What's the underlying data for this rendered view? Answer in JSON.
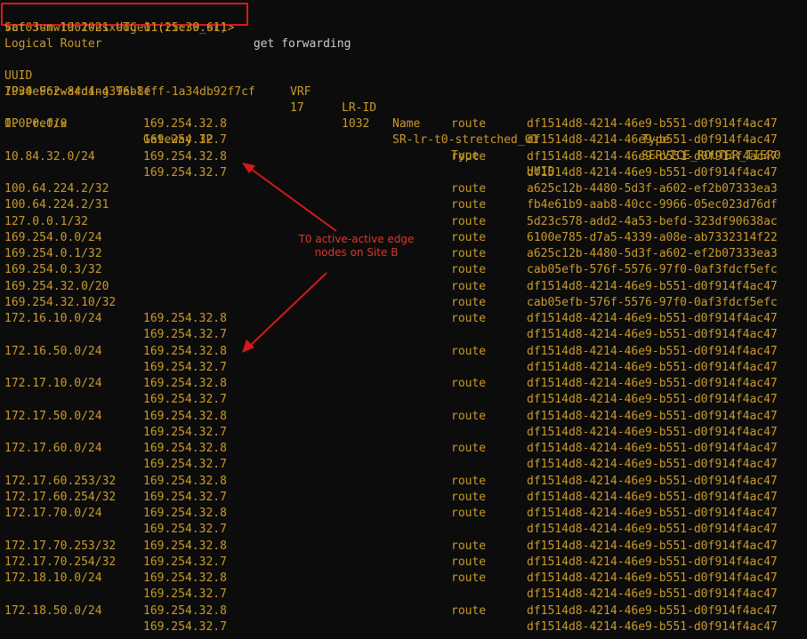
{
  "colors": {
    "background": "#0c0c0c",
    "text": "#ca9a2a",
    "command": "#cccccc",
    "annotation": "#d63a2a"
  },
  "prompt": {
    "host": "vcf03-mwld01-nsxedge01(tier0_sr)>",
    "command": " get forwarding"
  },
  "timestamp": "Sat Jun 19 2021 UTC 11:25:39.611",
  "logical_router_title": "Logical Router",
  "router_headers": {
    "uuid": "UUID",
    "vrf": "VRF",
    "lrid": "LR-ID",
    "name": "Name",
    "type": "Type"
  },
  "router": {
    "uuid": "7930e962-84d4-4396-8fff-1a34db92f7cf",
    "vrf": "17",
    "lrid": "1032",
    "name": "SR-lr-t0-stretched_01",
    "type": "SERVICE_ROUTER_TIER0"
  },
  "table_title": "IPv4 Forwarding Table",
  "table_headers": {
    "prefix": "IP Prefix",
    "gateway": "Gateway IP",
    "type": "Type",
    "uuid": "UUID"
  },
  "rows": [
    {
      "prefix": "0.0.0.0/0",
      "gateway": "169.254.32.8",
      "type": "route",
      "uuid": "df1514d8-4214-46e9-b551-d0f914f4ac47"
    },
    {
      "prefix": "",
      "gateway": "169.254.32.7",
      "type": "",
      "uuid": "df1514d8-4214-46e9-b551-d0f914f4ac47"
    },
    {
      "prefix": "10.84.32.0/24",
      "gateway": "169.254.32.8",
      "type": "route",
      "uuid": "df1514d8-4214-46e9-b551-d0f914f4ac47"
    },
    {
      "prefix": "",
      "gateway": "169.254.32.7",
      "type": "",
      "uuid": "df1514d8-4214-46e9-b551-d0f914f4ac47"
    },
    {
      "prefix": "100.64.224.2/32",
      "gateway": "",
      "type": "route",
      "uuid": "a625c12b-4480-5d3f-a602-ef2b07333ea3"
    },
    {
      "prefix": "100.64.224.2/31",
      "gateway": "",
      "type": "route",
      "uuid": "fb4e61b9-aab8-40cc-9966-05ec023d76df"
    },
    {
      "prefix": "127.0.0.1/32",
      "gateway": "",
      "type": "route",
      "uuid": "5d23c578-add2-4a53-befd-323df90638ac"
    },
    {
      "prefix": "169.254.0.0/24",
      "gateway": "",
      "type": "route",
      "uuid": "6100e785-d7a5-4339-a08e-ab7332314f22"
    },
    {
      "prefix": "169.254.0.1/32",
      "gateway": "",
      "type": "route",
      "uuid": "a625c12b-4480-5d3f-a602-ef2b07333ea3"
    },
    {
      "prefix": "169.254.0.3/32",
      "gateway": "",
      "type": "route",
      "uuid": "cab05efb-576f-5576-97f0-0af3fdcf5efc"
    },
    {
      "prefix": "169.254.32.0/20",
      "gateway": "",
      "type": "route",
      "uuid": "df1514d8-4214-46e9-b551-d0f914f4ac47"
    },
    {
      "prefix": "169.254.32.10/32",
      "gateway": "",
      "type": "route",
      "uuid": "cab05efb-576f-5576-97f0-0af3fdcf5efc"
    },
    {
      "prefix": "172.16.10.0/24",
      "gateway": "169.254.32.8",
      "type": "route",
      "uuid": "df1514d8-4214-46e9-b551-d0f914f4ac47"
    },
    {
      "prefix": "",
      "gateway": "169.254.32.7",
      "type": "",
      "uuid": "df1514d8-4214-46e9-b551-d0f914f4ac47"
    },
    {
      "prefix": "172.16.50.0/24",
      "gateway": "169.254.32.8",
      "type": "route",
      "uuid": "df1514d8-4214-46e9-b551-d0f914f4ac47"
    },
    {
      "prefix": "",
      "gateway": "169.254.32.7",
      "type": "",
      "uuid": "df1514d8-4214-46e9-b551-d0f914f4ac47"
    },
    {
      "prefix": "172.17.10.0/24",
      "gateway": "169.254.32.8",
      "type": "route",
      "uuid": "df1514d8-4214-46e9-b551-d0f914f4ac47"
    },
    {
      "prefix": "",
      "gateway": "169.254.32.7",
      "type": "",
      "uuid": "df1514d8-4214-46e9-b551-d0f914f4ac47"
    },
    {
      "prefix": "172.17.50.0/24",
      "gateway": "169.254.32.8",
      "type": "route",
      "uuid": "df1514d8-4214-46e9-b551-d0f914f4ac47"
    },
    {
      "prefix": "",
      "gateway": "169.254.32.7",
      "type": "",
      "uuid": "df1514d8-4214-46e9-b551-d0f914f4ac47"
    },
    {
      "prefix": "172.17.60.0/24",
      "gateway": "169.254.32.8",
      "type": "route",
      "uuid": "df1514d8-4214-46e9-b551-d0f914f4ac47"
    },
    {
      "prefix": "",
      "gateway": "169.254.32.7",
      "type": "",
      "uuid": "df1514d8-4214-46e9-b551-d0f914f4ac47"
    },
    {
      "prefix": "172.17.60.253/32",
      "gateway": "169.254.32.8",
      "type": "route",
      "uuid": "df1514d8-4214-46e9-b551-d0f914f4ac47"
    },
    {
      "prefix": "172.17.60.254/32",
      "gateway": "169.254.32.7",
      "type": "route",
      "uuid": "df1514d8-4214-46e9-b551-d0f914f4ac47"
    },
    {
      "prefix": "172.17.70.0/24",
      "gateway": "169.254.32.8",
      "type": "route",
      "uuid": "df1514d8-4214-46e9-b551-d0f914f4ac47"
    },
    {
      "prefix": "",
      "gateway": "169.254.32.7",
      "type": "",
      "uuid": "df1514d8-4214-46e9-b551-d0f914f4ac47"
    },
    {
      "prefix": "172.17.70.253/32",
      "gateway": "169.254.32.8",
      "type": "route",
      "uuid": "df1514d8-4214-46e9-b551-d0f914f4ac47"
    },
    {
      "prefix": "172.17.70.254/32",
      "gateway": "169.254.32.7",
      "type": "route",
      "uuid": "df1514d8-4214-46e9-b551-d0f914f4ac47"
    },
    {
      "prefix": "172.18.10.0/24",
      "gateway": "169.254.32.8",
      "type": "route",
      "uuid": "df1514d8-4214-46e9-b551-d0f914f4ac47"
    },
    {
      "prefix": "",
      "gateway": "169.254.32.7",
      "type": "",
      "uuid": "df1514d8-4214-46e9-b551-d0f914f4ac47"
    },
    {
      "prefix": "172.18.50.0/24",
      "gateway": "169.254.32.8",
      "type": "route",
      "uuid": "df1514d8-4214-46e9-b551-d0f914f4ac47"
    },
    {
      "prefix": "",
      "gateway": "169.254.32.7",
      "type": "",
      "uuid": "df1514d8-4214-46e9-b551-d0f914f4ac47"
    }
  ],
  "annotation": {
    "line1": "T0 active-active edge",
    "line2": "nodes on Site B"
  }
}
